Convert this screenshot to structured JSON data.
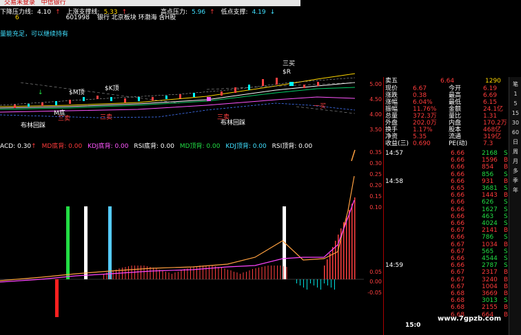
{
  "title_bar": {
    "login": "交易未登录",
    "broker": "中信银行"
  },
  "info_line": {
    "down_pressure_label": "下降压力线:",
    "down_pressure_value": "4.10",
    "up_support_label": "上涨支撑线:",
    "up_support_value": "5.33",
    "high_pressure_label": "高点压力:",
    "high_pressure_value": "5.96",
    "low_support_label": "低点支撑:",
    "low_support_value": "4.19"
  },
  "stock_line": {
    "num": "6",
    "code": "601998",
    "tags": "银行 北京板块 环渤海 含H股"
  },
  "energy_text": "量能充足，可以继续持有",
  "price_axis": [
    "5.00",
    "4.50",
    "4.00",
    "3.50"
  ],
  "macd_axis": [
    "0.35",
    "0.30",
    "0.25",
    "0.20",
    "0.15",
    "0.10",
    "0.05",
    "0.00",
    "-0.05"
  ],
  "chart_labels": {
    "m_top": "$M顶",
    "k_top": "$K顶",
    "san_mai": "三卖",
    "m_bottom": "M底",
    "bollinger": "布林回踩",
    "three_buy": "三买",
    "r_label": "$R",
    "san_mai2": "三卖",
    "buy_mark": "一买"
  },
  "indicator_line": {
    "macd": "ACD: 0.30",
    "md_bottom": "MD底背: 0.00",
    "kdj_bottom": "KDJ底背: 0.00",
    "rsi_bottom": "RSI底背: 0.00",
    "md_top": "MD顶背: 0.00",
    "kdj_top": "KDJ顶背: 0.00",
    "rsi_top": "RSI顶背: 0.00"
  },
  "quote": {
    "sell5": {
      "label": "卖五",
      "price": "6.64",
      "vol": "1290"
    },
    "rows": [
      {
        "l1": "现价",
        "v1": "6.67",
        "l2": "今开",
        "v2": "6.19"
      },
      {
        "l1": "涨跌",
        "v1": "0.38",
        "l2": "最高",
        "v2": "6.69"
      },
      {
        "l1": "涨幅",
        "v1": "6.04%",
        "l2": "最低",
        "v2": "6.15"
      },
      {
        "l1": "振幅",
        "v1": "11.76%",
        "l2": "金额",
        "v2": "24.1亿"
      },
      {
        "l1": "总量",
        "v1": "372.3万",
        "l2": "量比",
        "v2": "1.31"
      },
      {
        "l1": "外盘",
        "v1": "202.0万",
        "l2": "内盘",
        "v2": "170.2万"
      },
      {
        "l1": "换手",
        "v1": "1.17%",
        "l2": "股本",
        "v2": "468亿"
      },
      {
        "l1": "净资",
        "v1": "5.35",
        "l2": "流通",
        "v2": "319亿"
      },
      {
        "l1": "收益(三)",
        "v1": "0.690",
        "l2": "PE(动)",
        "v2": "7.3"
      }
    ]
  },
  "trades": [
    {
      "t": "14:57",
      "p": "6.66",
      "v": "2168",
      "s": "S"
    },
    {
      "t": "",
      "p": "6.66",
      "v": "1596",
      "s": "B"
    },
    {
      "t": "",
      "p": "6.66",
      "v": "854",
      "s": "B"
    },
    {
      "t": "",
      "p": "6.66",
      "v": "856",
      "s": "S"
    },
    {
      "t": "14:58",
      "p": "6.66",
      "v": "931",
      "s": "B"
    },
    {
      "t": "",
      "p": "6.65",
      "v": "3681",
      "s": "S"
    },
    {
      "t": "",
      "p": "6.66",
      "v": "1443",
      "s": "B"
    },
    {
      "t": "",
      "p": "6.66",
      "v": "626",
      "s": "S"
    },
    {
      "t": "",
      "p": "6.66",
      "v": "1627",
      "s": "S"
    },
    {
      "t": "",
      "p": "6.66",
      "v": "463",
      "s": "S"
    },
    {
      "t": "",
      "p": "6.66",
      "v": "4024",
      "s": "S"
    },
    {
      "t": "",
      "p": "6.67",
      "v": "2141",
      "s": "B"
    },
    {
      "t": "",
      "p": "6.66",
      "v": "786",
      "s": "S"
    },
    {
      "t": "",
      "p": "6.67",
      "v": "1034",
      "s": "B"
    },
    {
      "t": "",
      "p": "6.67",
      "v": "565",
      "s": "S"
    },
    {
      "t": "",
      "p": "6.66",
      "v": "4544",
      "s": "S"
    },
    {
      "t": "14:59",
      "p": "6.66",
      "v": "2787",
      "s": "S"
    },
    {
      "t": "",
      "p": "6.67",
      "v": "2317",
      "s": "B"
    },
    {
      "t": "",
      "p": "6.67",
      "v": "3240",
      "s": "B"
    },
    {
      "t": "",
      "p": "6.67",
      "v": "1004",
      "s": "B"
    },
    {
      "t": "",
      "p": "6.68",
      "v": "3669",
      "s": "B"
    },
    {
      "t": "",
      "p": "6.68",
      "v": "3013",
      "s": "S"
    },
    {
      "t": "",
      "p": "6.68",
      "v": "2155",
      "s": "B"
    },
    {
      "t": "",
      "p": "6.68",
      "v": "664",
      "s": "B"
    }
  ],
  "time_label": "15:0",
  "toolbar": [
    "笔",
    "1",
    "5",
    "15",
    "30",
    "60",
    "日",
    "周",
    "月",
    "多",
    "季",
    "年"
  ],
  "watermark": "www.7gpzb.com"
}
